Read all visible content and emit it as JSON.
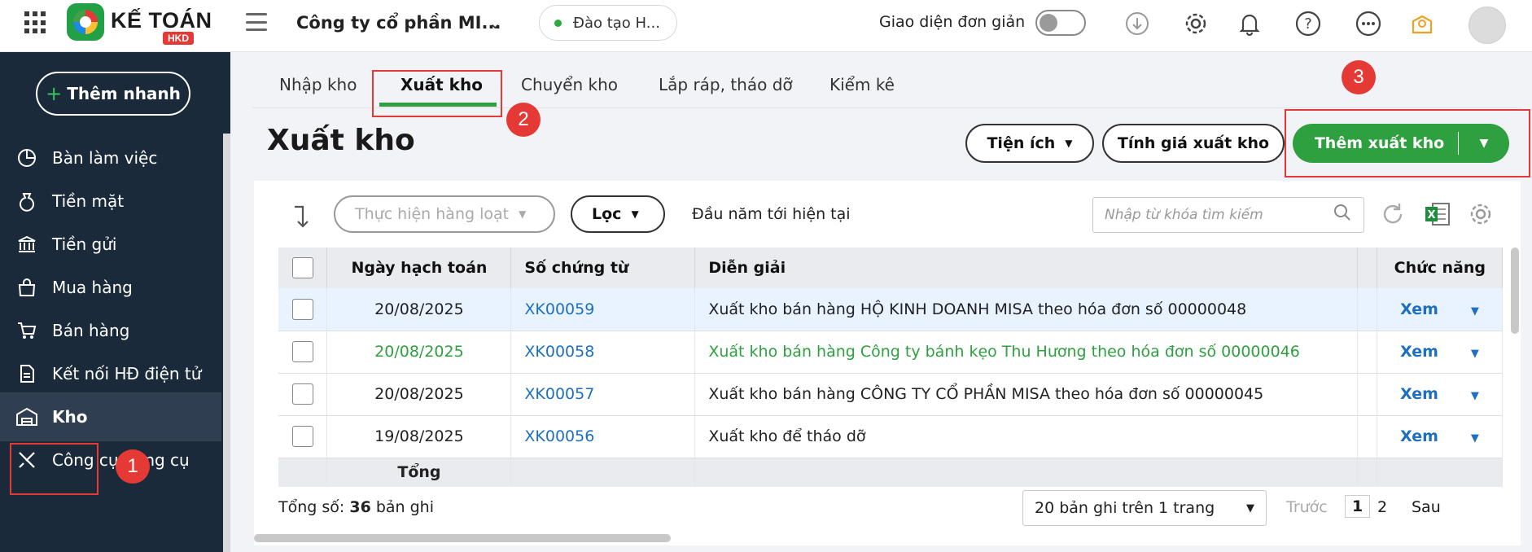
{
  "brand": {
    "name": "KẾ TOÁN",
    "badge": "HKD"
  },
  "company": "Công ty cổ phần MI...",
  "environment": "Đào tạo H...",
  "simple_ui_label": "Giao diện đơn giản",
  "header_icons": [
    "download-icon",
    "gear-icon",
    "bell-icon",
    "help-icon",
    "more-icon",
    "lightbulb-icon"
  ],
  "sidebar": {
    "quick_add": "Thêm nhanh",
    "items": [
      {
        "label": "Bàn làm việc",
        "icon": "dashboard-icon"
      },
      {
        "label": "Tiền mặt",
        "icon": "money-bag-icon"
      },
      {
        "label": "Tiền gửi",
        "icon": "bank-icon"
      },
      {
        "label": "Mua hàng",
        "icon": "shopping-bag-icon"
      },
      {
        "label": "Bán hàng",
        "icon": "cart-icon"
      },
      {
        "label": "Kết nối HĐ điện tử",
        "icon": "invoice-icon"
      },
      {
        "label": "Kho",
        "icon": "warehouse-icon"
      },
      {
        "label": "Công cụ dụng cụ",
        "icon": "tools-icon"
      }
    ]
  },
  "tabs": [
    "Nhập kho",
    "Xuất kho",
    "Chuyển kho",
    "Lắp ráp, tháo dỡ",
    "Kiểm kê"
  ],
  "page_title": "Xuất kho",
  "actions": {
    "utilities": "Tiện ích",
    "calc_price": "Tính giá xuất kho",
    "add": "Thêm xuất kho"
  },
  "annotations": [
    "1",
    "2",
    "3"
  ],
  "filters": {
    "bulk": "Thực hiện hàng loạt",
    "filter": "Lọc",
    "date_range": "Đầu năm tới hiện tại",
    "search_placeholder": "Nhập từ khóa tìm kiếm"
  },
  "table": {
    "headers": {
      "date": "Ngày hạch toán",
      "doc": "Số chứng từ",
      "desc": "Diễn giải",
      "func": "Chức năng"
    },
    "rows": [
      {
        "date": "20/08/2025",
        "doc": "XK00059",
        "desc": "Xuất kho bán hàng HỘ KINH DOANH MISA theo hóa đơn số 00000048",
        "action": "Xem"
      },
      {
        "date": "20/08/2025",
        "doc": "XK00058",
        "desc": "Xuất kho bán hàng Công ty bánh kẹo Thu Hương theo hóa đơn số 00000046",
        "action": "Xem"
      },
      {
        "date": "20/08/2025",
        "doc": "XK00057",
        "desc": "Xuất kho bán hàng CÔNG TY CỔ PHẦN MISA theo hóa đơn số 00000045",
        "action": "Xem"
      },
      {
        "date": "19/08/2025",
        "doc": "XK00056",
        "desc": "Xuất kho để tháo dỡ",
        "action": "Xem"
      }
    ],
    "total_label": "Tổng"
  },
  "footer": {
    "total_prefix": "Tổng số: ",
    "total_count": "36",
    "total_suffix": " bản ghi",
    "page_size": "20 bản ghi trên 1 trang",
    "prev": "Trước",
    "pages": [
      "1",
      "2"
    ],
    "next": "Sau"
  },
  "colors": {
    "sidebar": "#1b2a3b",
    "accent_green": "#2ea03f",
    "link_blue": "#1e6fc0",
    "annotation_red": "#e53935"
  }
}
